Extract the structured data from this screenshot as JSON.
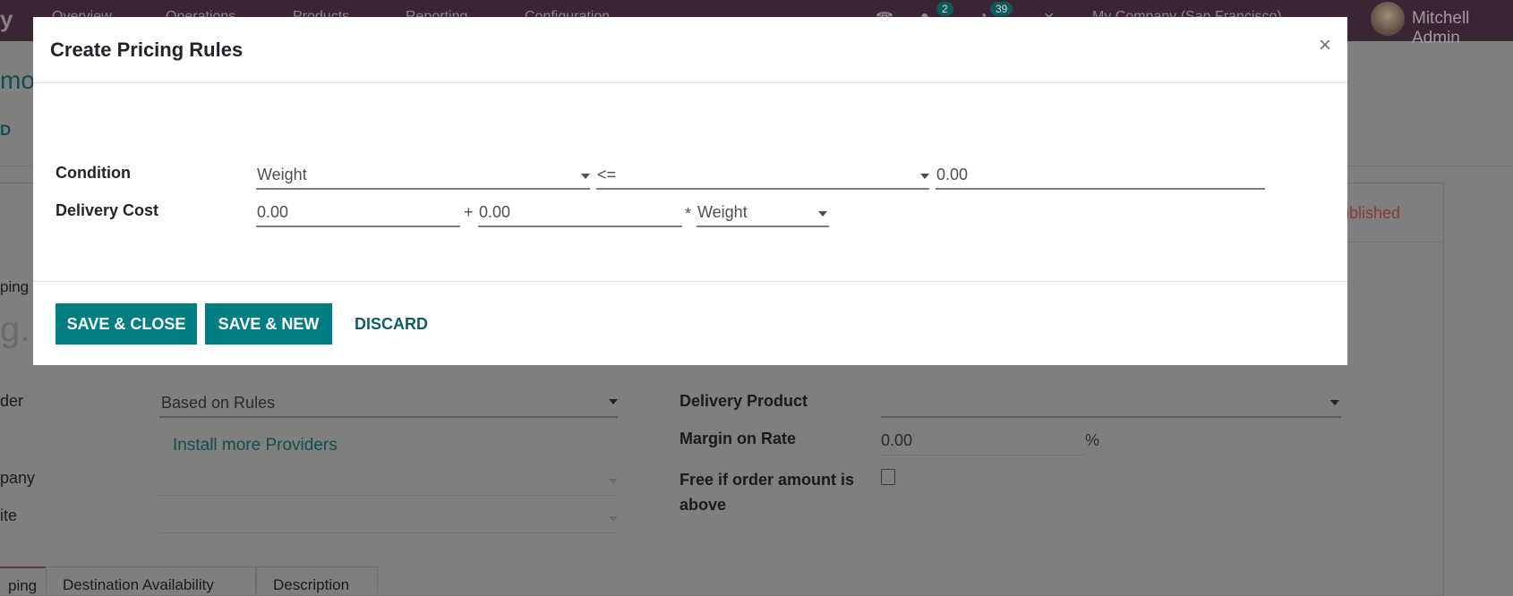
{
  "navbar": {
    "brand": "y",
    "menu": [
      "Overview",
      "Operations",
      "Products",
      "Reporting",
      "Configuration"
    ],
    "chat_badge": "2",
    "activity_badge": "39",
    "company": "My Company (San Francisco)",
    "user": "Mitchell Admin"
  },
  "background_form": {
    "title_partial": "mod",
    "action_partial": "D",
    "published_status": "ublished",
    "shipping_label_partial": "ping",
    "name_placeholder_partial": "g.",
    "provider_label_partial": "der",
    "provider_value": "Based on Rules",
    "install_providers_link": "Install more Providers",
    "company_label_partial": "pany",
    "website_label_partial": "ite",
    "delivery_product_label": "Delivery Product",
    "delivery_product_value": "",
    "margin_label": "Margin on Rate",
    "margin_value": "0.00",
    "margin_unit": "%",
    "free_label": "Free if order amount is above",
    "free_checked": false,
    "tabs": [
      "ping",
      "Destination Availability",
      "Description"
    ]
  },
  "dialog": {
    "title": "Create Pricing Rules",
    "close_label": "×",
    "condition": {
      "label": "Condition",
      "variable": "Weight",
      "operator": "<=",
      "max_value": "0.00"
    },
    "delivery_cost": {
      "label": "Delivery Cost",
      "list_base_price": "0.00",
      "plus_sign": "+",
      "list_price": "0.00",
      "times_sign": "*",
      "variable_factor": "Weight"
    },
    "buttons": {
      "save_close": "SAVE & CLOSE",
      "save_new": "SAVE & NEW",
      "discard": "DISCARD"
    }
  },
  "colors": {
    "primary": "#017e84",
    "navbar": "#3a2534",
    "overlay": "#7f7f7f"
  }
}
